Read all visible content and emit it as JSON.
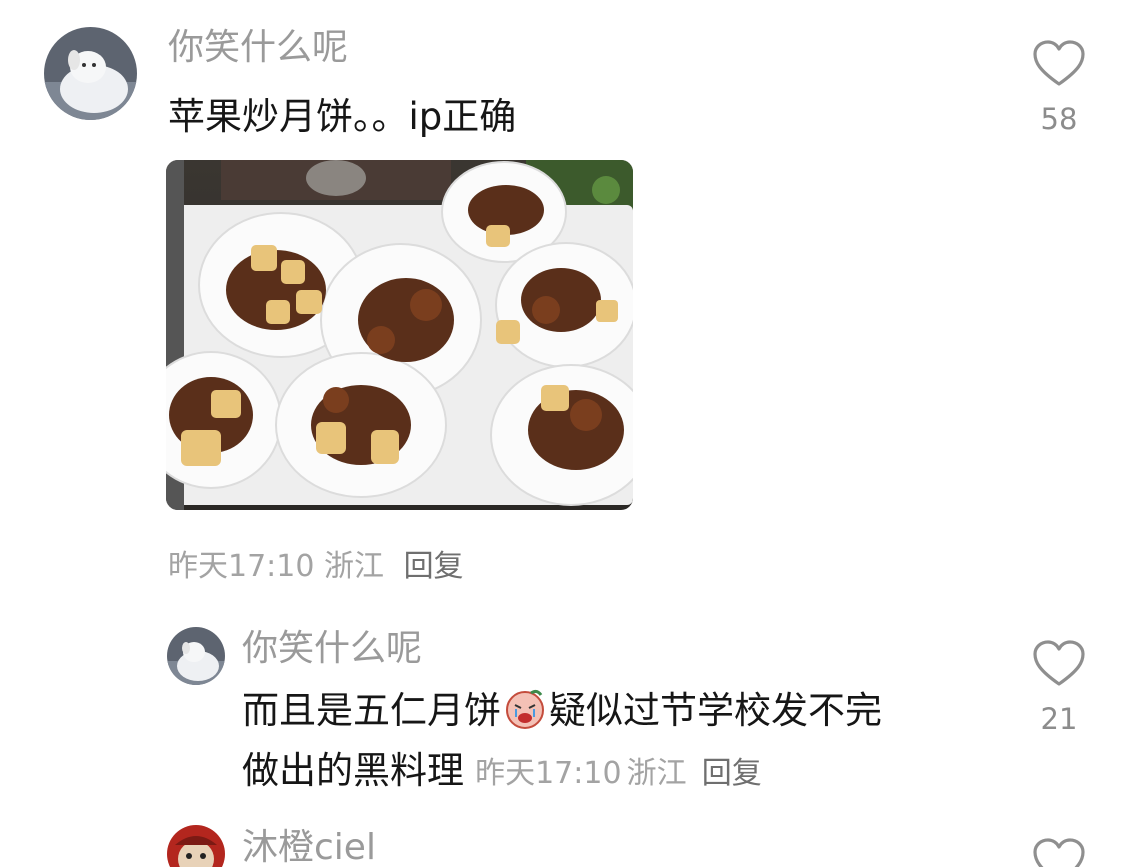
{
  "comments": [
    {
      "username": "你笑什么呢",
      "text": "苹果炒月饼。。ip正确",
      "time": "昨天17:10",
      "location": "浙江",
      "reply_label": "回复",
      "likes": "58",
      "like_icon": "heart-outline-icon"
    },
    {
      "username": "你笑什么呢",
      "text_before_emoji": "而且是五仁月饼",
      "emoji": "crying-face-emoji",
      "text_line1_after_emoji": "疑似过节学校发不完",
      "text_line2": "做出的黑料理",
      "time": "昨天17:10",
      "location": "浙江",
      "reply_label": "回复",
      "likes": "21",
      "like_icon": "heart-outline-icon"
    },
    {
      "username": "沐橙ciel",
      "like_icon": "heart-outline-icon"
    }
  ],
  "colors": {
    "username": "#9a9a9a",
    "text": "#161616",
    "meta": "#a3a3a3",
    "reply": "#6f6f6f"
  }
}
